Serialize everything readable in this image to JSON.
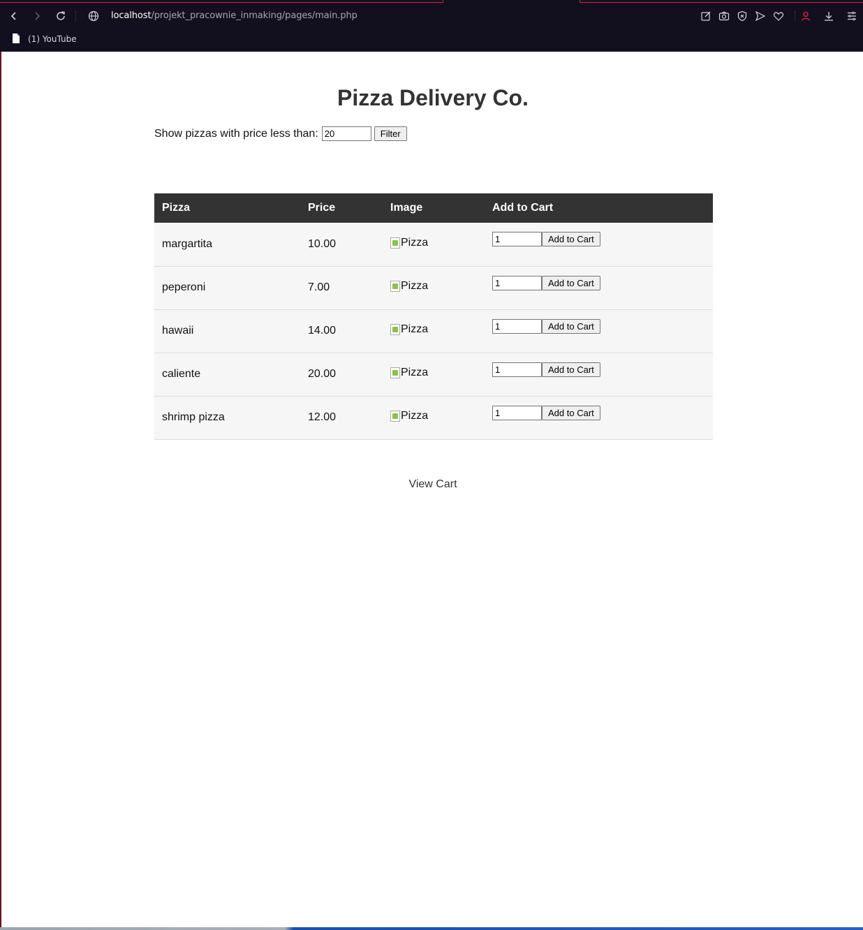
{
  "browser": {
    "url_host": "localhost",
    "url_path": "/projekt_pracownie_inmaking/pages/main.php",
    "bookmarks": [
      {
        "label": "(1) YouTube"
      }
    ],
    "accent_color": "#d4233c"
  },
  "page": {
    "title": "Pizza Delivery Co.",
    "filter": {
      "label": "Show pizzas with price less than:",
      "value": "20",
      "button_label": "Filter"
    },
    "table": {
      "headers": [
        "Pizza",
        "Price",
        "Image",
        "Add to Cart"
      ],
      "rows": [
        {
          "name": "margartita",
          "price": "10.00",
          "image_alt": "Pizza",
          "qty": "1",
          "button": "Add to Cart"
        },
        {
          "name": "peperoni",
          "price": "7.00",
          "image_alt": "Pizza",
          "qty": "1",
          "button": "Add to Cart"
        },
        {
          "name": "hawaii",
          "price": "14.00",
          "image_alt": "Pizza",
          "qty": "1",
          "button": "Add to Cart"
        },
        {
          "name": "caliente",
          "price": "20.00",
          "image_alt": "Pizza",
          "qty": "1",
          "button": "Add to Cart"
        },
        {
          "name": "shrimp pizza",
          "price": "12.00",
          "image_alt": "Pizza",
          "qty": "1",
          "button": "Add to Cart"
        }
      ]
    },
    "view_cart_label": "View Cart"
  }
}
